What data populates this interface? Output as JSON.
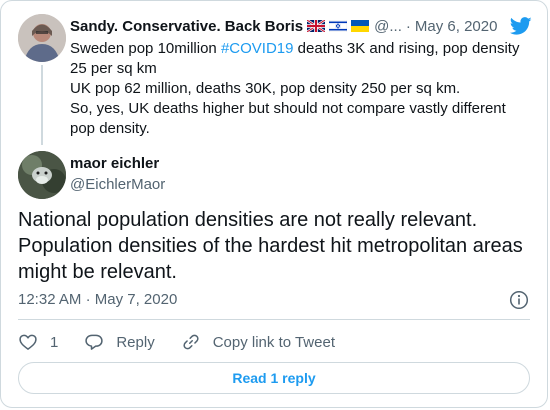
{
  "parent_tweet": {
    "name": "Sandy. Conservative. Back Boris",
    "flags": [
      "uk-flag-icon",
      "israel-flag-icon",
      "ukraine-flag-icon"
    ],
    "handle_truncated": "@...",
    "separator": "·",
    "date": "May 6, 2020",
    "text_before": "Sweden pop 10million ",
    "hashtag": "#COVID19",
    "text_after": " deaths 3K and rising, pop density 25 per sq km",
    "line2": "UK pop 62 million, deaths 30K, pop density 250 per sq km.",
    "line3": "So, yes, UK deaths higher but should not compare vastly different pop density."
  },
  "author": {
    "name": "maor eichler",
    "handle": "@EichlerMaor"
  },
  "tweet": {
    "text": "National population densities are not really relevant. Population densities of the hardest hit metropolitan areas might be relevant.",
    "time": "12:32 AM",
    "separator": "·",
    "date": "May 7, 2020"
  },
  "actions": {
    "like_count": "1",
    "reply_label": "Reply",
    "copy_link_label": "Copy link to Tweet"
  },
  "read_replies_label": "Read 1 reply",
  "colors": {
    "accent": "#1d9bf0",
    "text": "#0f1419",
    "secondary": "#536471",
    "border": "#cfd9de"
  }
}
